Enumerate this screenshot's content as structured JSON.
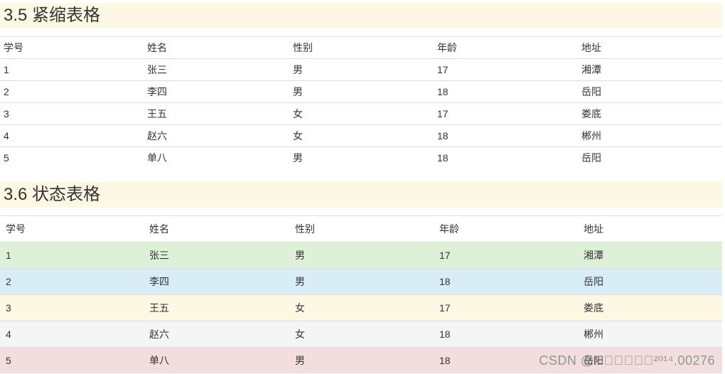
{
  "sections": [
    {
      "title": "3.5 紧缩表格",
      "headers": [
        "学号",
        "姓名",
        "性别",
        "年龄",
        "地址"
      ],
      "rows": [
        [
          "1",
          "张三",
          "男",
          "17",
          "湘潭"
        ],
        [
          "2",
          "李四",
          "男",
          "18",
          "岳阳"
        ],
        [
          "3",
          "王五",
          "女",
          "17",
          "娄底"
        ],
        [
          "4",
          "赵六",
          "女",
          "18",
          "郴州"
        ],
        [
          "5",
          "单八",
          "男",
          "18",
          "岳阳"
        ]
      ]
    },
    {
      "title": "3.6 状态表格",
      "headers": [
        "学号",
        "姓名",
        "性别",
        "年龄",
        "地址"
      ],
      "rows": [
        [
          "1",
          "张三",
          "男",
          "17",
          "湘潭"
        ],
        [
          "2",
          "李四",
          "男",
          "18",
          "岳阳"
        ],
        [
          "3",
          "王五",
          "女",
          "17",
          "娄底"
        ],
        [
          "4",
          "赵六",
          "女",
          "18",
          "郴州"
        ],
        [
          "5",
          "单八",
          "男",
          "18",
          "岳阳"
        ]
      ],
      "row_colors": [
        "#dff0d8",
        "#d9edf7",
        "#fcf8e3",
        "#f5f5f5",
        "#f2dede"
      ]
    }
  ],
  "watermark": "CSDN @\u0000\u0000\u0000\u0000\u0000\u0000²º¹⁴.00276"
}
